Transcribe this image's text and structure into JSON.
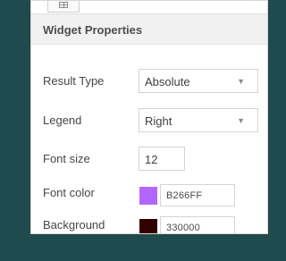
{
  "panel": {
    "title": "Widget Properties",
    "tab_icon": "grid-icon"
  },
  "fields": {
    "result_type": {
      "label": "Result Type",
      "value": "Absolute"
    },
    "legend": {
      "label": "Legend",
      "value": "Right"
    },
    "font_size": {
      "label": "Font size",
      "value": "12"
    },
    "font_color": {
      "label": "Font color",
      "value": "B266FF",
      "swatch": "#b266ff"
    },
    "background": {
      "label": "Background",
      "value": "330000",
      "swatch": "#330000"
    }
  },
  "icons": {
    "dropdown": "chevron-down-icon"
  }
}
